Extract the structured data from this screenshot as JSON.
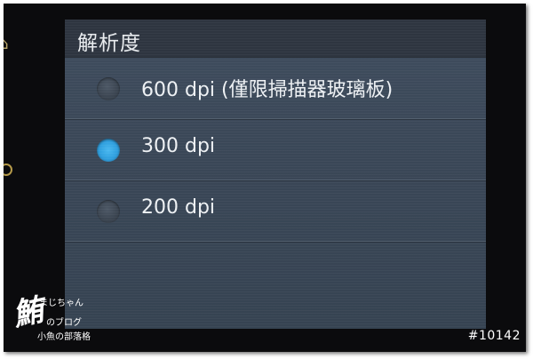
{
  "screen": {
    "title": "解析度",
    "options": [
      {
        "label": "600 dpi (僅限掃描器玻璃板)",
        "selected": false
      },
      {
        "label": "300 dpi",
        "selected": true
      },
      {
        "label": "200 dpi",
        "selected": false
      }
    ],
    "accent_color": "#2f9fde"
  },
  "bezel": {
    "icons": [
      "home-icon",
      "power-icon"
    ]
  },
  "watermark": {
    "line1": "まじちゃん",
    "line2": "のブログ",
    "line3": "小魚の部落格"
  },
  "photo_number": "#10142"
}
